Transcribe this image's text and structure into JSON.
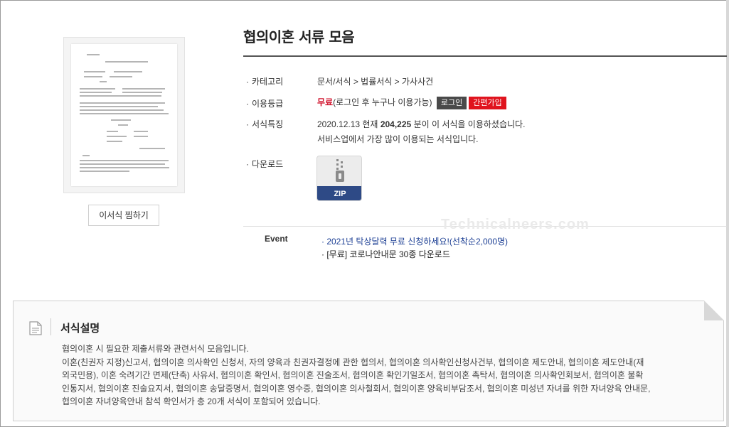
{
  "title": "협의이혼 서류 모음",
  "favorite_button": "이서식 찜하기",
  "info": {
    "category_label": "카테고리",
    "category_value": "문서/서식 > 법률서식 > 가사사건",
    "grade_label": "이용등급",
    "grade_free": "무료",
    "grade_note": "(로그인 후 누구나 이용가능)",
    "login_button": "로그인",
    "join_button": "간편가입",
    "feature_label": "서식특징",
    "feature_date": "2020.12.13 현재",
    "feature_count": "204,225",
    "feature_suffix": "분이 이 서식을 이용하셨습니다.",
    "feature_line2": "서비스업에서 가장 많이 이용되는 서식입니다.",
    "download_label": "다운로드",
    "zip_label": "ZIP"
  },
  "watermark": "Technicalneers.com",
  "event": {
    "label": "Event",
    "items": [
      "· 2021년 탁상달력 무료 신청하세요!(선착순2,000명)",
      "· [무료] 코로나안내문 30종 다운로드"
    ]
  },
  "description": {
    "title": "서식설명",
    "lines": [
      "협의이혼 시 필요한 제출서류와 관련서식 모음입니다.",
      "이혼(친권자 지정)신고서, 협의이혼 의사확인 신청서, 자의 양육과 친권자결정에 관한 협의서, 협의이혼 의사확인신청사건부, 협의이혼 제도안내, 협의이혼 제도안내(재",
      "외국민용), 이혼 숙려기간 면제(단축) 사유서, 협의이혼 확인서, 협의이혼 진술조서, 협의이혼 확인기일조서, 협의이혼 촉탁서, 협의이혼 의사확인회보서, 협의이혼 불확",
      "인통지서, 협의이혼 진술요지서, 협의이혼 송달증명서, 협의이혼 영수증, 협의이혼 의사철회서, 협의이혼 양육비부담조서, 협의이혼 미성년 자녀를 위한 자녀양육 안내문,",
      "협의이혼 자녀양육안내 참석 확인서가 총 20개 서식이 포함되어 있습니다."
    ]
  },
  "colors": {
    "free_red": "#d0112b",
    "join_red": "#e0141e",
    "event_blue": "#1c3f94",
    "zip_blue": "#2e4a86"
  }
}
